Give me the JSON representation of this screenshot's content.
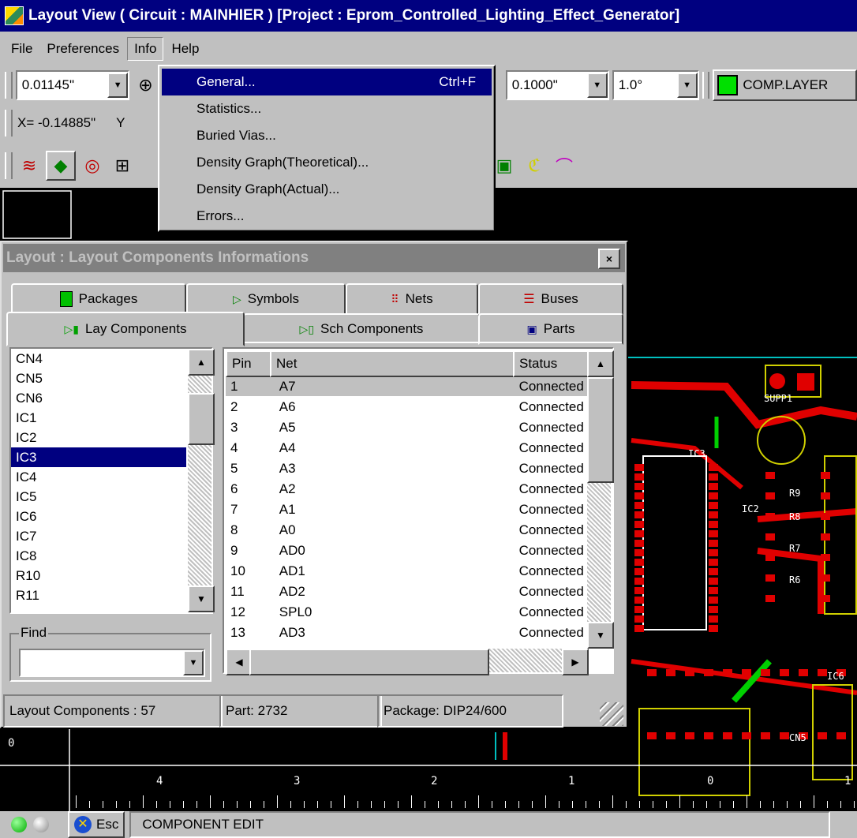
{
  "window": {
    "title": "Layout View ( Circuit : MAINHIER ) [Project : Eprom_Controlled_Lighting_Effect_Generator]"
  },
  "menubar": {
    "items": [
      {
        "label": "File"
      },
      {
        "label": "Preferences"
      },
      {
        "label": "Info"
      },
      {
        "label": "Help"
      }
    ]
  },
  "toolbar": {
    "zoom_value": "0.01145\"",
    "grid_value": "0.1000\"",
    "angle_value": "1.0°",
    "layer_label": "COMP.LAYER",
    "layer_color": "#00e000",
    "coord_x": "X= -0.14885\"",
    "coord_y": "Y"
  },
  "info_menu": {
    "items": [
      {
        "label": "General...",
        "shortcut": "Ctrl+F"
      },
      {
        "label": "Statistics...",
        "shortcut": ""
      },
      {
        "label": "Buried Vias...",
        "shortcut": ""
      },
      {
        "label": "Density Graph(Theoretical)...",
        "shortcut": ""
      },
      {
        "label": "Density Graph(Actual)...",
        "shortcut": ""
      },
      {
        "label": "Errors...",
        "shortcut": ""
      }
    ]
  },
  "dialog": {
    "title": "Layout : Layout Components Informations",
    "tabs_row1": [
      {
        "label": "Packages"
      },
      {
        "label": "Symbols"
      },
      {
        "label": "Nets"
      },
      {
        "label": "Buses"
      }
    ],
    "tabs_row2": [
      {
        "label": "Lay Components"
      },
      {
        "label": "Sch Components"
      },
      {
        "label": "Parts"
      }
    ],
    "components": [
      "CN4",
      "CN5",
      "CN6",
      "IC1",
      "IC2",
      "IC3",
      "IC4",
      "IC5",
      "IC6",
      "IC7",
      "IC8",
      "R10",
      "R11"
    ],
    "selected_component": "IC3",
    "find_label": "Find",
    "find_value": "",
    "table_headers": {
      "pin": "Pin",
      "net": "Net",
      "status": "Status"
    },
    "rows": [
      {
        "pin": "1",
        "net": "A7",
        "status": "Connected"
      },
      {
        "pin": "2",
        "net": "A6",
        "status": "Connected"
      },
      {
        "pin": "3",
        "net": "A5",
        "status": "Connected"
      },
      {
        "pin": "4",
        "net": "A4",
        "status": "Connected"
      },
      {
        "pin": "5",
        "net": "A3",
        "status": "Connected"
      },
      {
        "pin": "6",
        "net": "A2",
        "status": "Connected"
      },
      {
        "pin": "7",
        "net": "A1",
        "status": "Connected"
      },
      {
        "pin": "8",
        "net": "A0",
        "status": "Connected"
      },
      {
        "pin": "9",
        "net": "AD0",
        "status": "Connected"
      },
      {
        "pin": "10",
        "net": "AD1",
        "status": "Connected"
      },
      {
        "pin": "11",
        "net": "AD2",
        "status": "Connected"
      },
      {
        "pin": "12",
        "net": "SPL0",
        "status": "Connected"
      },
      {
        "pin": "13",
        "net": "AD3",
        "status": "Connected"
      }
    ],
    "status_components": "Layout Components :  57",
    "status_part": "Part: 2732",
    "status_package": "Package: DIP24/600"
  },
  "ruler": {
    "marks": [
      "4",
      "3",
      "2",
      "1",
      "0",
      "1"
    ],
    "left_label": "0"
  },
  "statusbar": {
    "esc_label": "Esc",
    "mode": "COMPONENT EDIT"
  },
  "pcb_labels": [
    "SUPP1",
    "IC3",
    "IC2",
    "R9",
    "R8",
    "R7",
    "R6",
    "CN5",
    "IC6"
  ]
}
